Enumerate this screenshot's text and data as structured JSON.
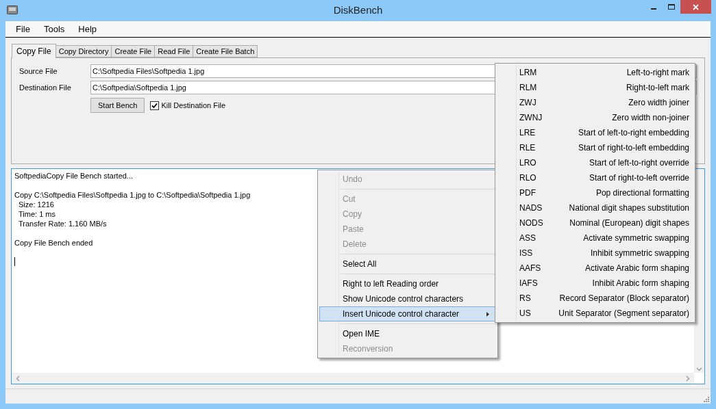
{
  "window": {
    "title": "DiskBench"
  },
  "menu_bar": [
    "File",
    "Tools",
    "Help"
  ],
  "tabs": [
    {
      "label": "Copy File",
      "selected": true
    },
    {
      "label": "Copy Directory",
      "selected": false
    },
    {
      "label": "Create File",
      "selected": false
    },
    {
      "label": "Read File",
      "selected": false
    },
    {
      "label": "Create File Batch",
      "selected": false
    }
  ],
  "form": {
    "fields": [
      {
        "label": "Source File",
        "value": "C:\\Softpedia Files\\Softpedia 1.jpg"
      },
      {
        "label": "Destination File",
        "value": "C:\\Softpedia\\Softpedia 1.jpg"
      }
    ],
    "start_button": "Start Bench",
    "kill_checkbox": {
      "label": "Kill Destination File",
      "checked": true
    }
  },
  "log": {
    "blocks": [
      {
        "lines": [
          {
            "text": "SoftpediaCopy File Bench started...",
            "indent": false
          }
        ]
      },
      {
        "lines": [
          {
            "text": "Copy C:\\Softpedia Files\\Softpedia 1.jpg to C:\\Softpedia\\Softpedia 1.jpg",
            "indent": false
          },
          {
            "text": "Size: 1216",
            "indent": true
          },
          {
            "text": "Time: 1 ms",
            "indent": true
          },
          {
            "text": "Transfer Rate: 1.160 MB/s",
            "indent": true
          }
        ]
      },
      {
        "lines": [
          {
            "text": "Copy File Bench ended",
            "indent": false
          }
        ]
      }
    ]
  },
  "context_menu": [
    {
      "kind": "item",
      "label": "Undo",
      "disabled": true,
      "selected": false,
      "submenu": false
    },
    {
      "kind": "separator"
    },
    {
      "kind": "item",
      "label": "Cut",
      "disabled": true,
      "selected": false,
      "submenu": false
    },
    {
      "kind": "item",
      "label": "Copy",
      "disabled": true,
      "selected": false,
      "submenu": false
    },
    {
      "kind": "item",
      "label": "Paste",
      "disabled": true,
      "selected": false,
      "submenu": false
    },
    {
      "kind": "item",
      "label": "Delete",
      "disabled": true,
      "selected": false,
      "submenu": false
    },
    {
      "kind": "separator"
    },
    {
      "kind": "item",
      "label": "Select All",
      "disabled": false,
      "selected": false,
      "submenu": false
    },
    {
      "kind": "separator"
    },
    {
      "kind": "item",
      "label": "Right to left Reading order",
      "disabled": false,
      "selected": false,
      "submenu": false
    },
    {
      "kind": "item",
      "label": "Show Unicode control characters",
      "disabled": false,
      "selected": false,
      "submenu": false
    },
    {
      "kind": "item",
      "label": "Insert Unicode control character",
      "disabled": false,
      "selected": true,
      "submenu": true
    },
    {
      "kind": "separator"
    },
    {
      "kind": "item",
      "label": "Open IME",
      "disabled": false,
      "selected": false,
      "submenu": false
    },
    {
      "kind": "item",
      "label": "Reconversion",
      "disabled": true,
      "selected": false,
      "submenu": false
    }
  ],
  "submenu": [
    {
      "code": "LRM",
      "description": "Left-to-right mark"
    },
    {
      "code": "RLM",
      "description": "Right-to-left mark"
    },
    {
      "code": "ZWJ",
      "description": "Zero width joiner"
    },
    {
      "code": "ZWNJ",
      "description": "Zero width non-joiner"
    },
    {
      "code": "LRE",
      "description": "Start of left-to-right embedding"
    },
    {
      "code": "RLE",
      "description": "Start of right-to-left embedding"
    },
    {
      "code": "LRO",
      "description": "Start of left-to-right override"
    },
    {
      "code": "RLO",
      "description": "Start of right-to-left override"
    },
    {
      "code": "PDF",
      "description": "Pop directional formatting"
    },
    {
      "code": "NADS",
      "description": "National digit shapes substitution"
    },
    {
      "code": "NODS",
      "description": "Nominal (European) digit shapes"
    },
    {
      "code": "ASS",
      "description": "Activate symmetric swapping"
    },
    {
      "code": "ISS",
      "description": "Inhibit symmetric swapping"
    },
    {
      "code": "AAFS",
      "description": "Activate Arabic form shaping"
    },
    {
      "code": "IAFS",
      "description": "Inhibit Arabic form shaping"
    },
    {
      "code": "RS",
      "description": "Record Separator (Block separator)"
    },
    {
      "code": "US",
      "description": "Unit Separator (Segment separator)"
    }
  ]
}
